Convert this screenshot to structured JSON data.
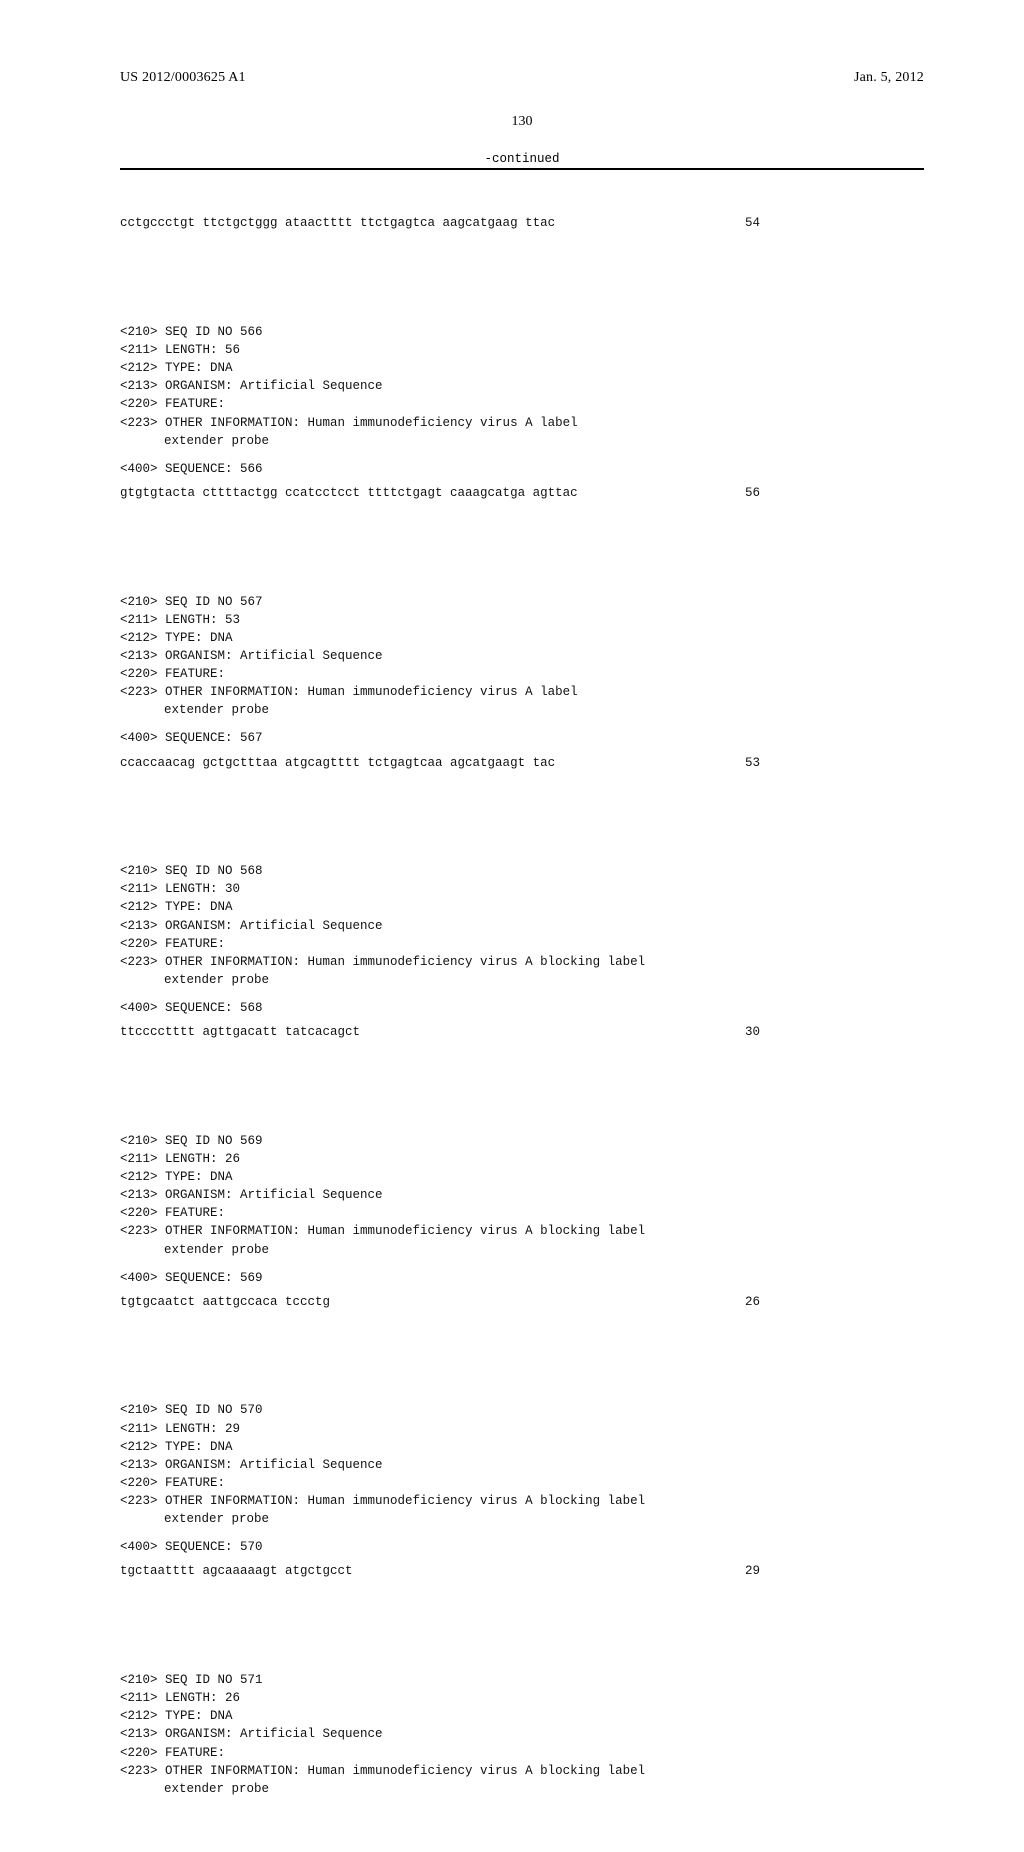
{
  "header": {
    "pub_number": "US 2012/0003625 A1",
    "pub_date": "Jan. 5, 2012"
  },
  "page_number": "130",
  "continued_label": "-continued",
  "initial_seq": {
    "line": "cctgccctgt ttctgctggg ataactttt ttctgagtca aagcatgaag ttac",
    "idx": "54"
  },
  "entries": [
    {
      "seq_id": "<210> SEQ ID NO 566",
      "length": "<211> LENGTH: 56",
      "type": "<212> TYPE: DNA",
      "organism": "<213> ORGANISM: Artificial Sequence",
      "feature": "<220> FEATURE:",
      "other_info_1": "<223> OTHER INFORMATION: Human immunodeficiency virus A label",
      "other_info_2": "extender probe",
      "seq_header": "<400> SEQUENCE: 566",
      "seq_line": "gtgtgtacta cttttactgg ccatcctcct ttttctgagt caaagcatga agttac",
      "seq_idx": "56"
    },
    {
      "seq_id": "<210> SEQ ID NO 567",
      "length": "<211> LENGTH: 53",
      "type": "<212> TYPE: DNA",
      "organism": "<213> ORGANISM: Artificial Sequence",
      "feature": "<220> FEATURE:",
      "other_info_1": "<223> OTHER INFORMATION: Human immunodeficiency virus A label",
      "other_info_2": "extender probe",
      "seq_header": "<400> SEQUENCE: 567",
      "seq_line": "ccaccaacag gctgctttaa atgcagtttt tctgagtcaa agcatgaagt tac",
      "seq_idx": "53"
    },
    {
      "seq_id": "<210> SEQ ID NO 568",
      "length": "<211> LENGTH: 30",
      "type": "<212> TYPE: DNA",
      "organism": "<213> ORGANISM: Artificial Sequence",
      "feature": "<220> FEATURE:",
      "other_info_1": "<223> OTHER INFORMATION: Human immunodeficiency virus A blocking label",
      "other_info_2": "extender probe",
      "seq_header": "<400> SEQUENCE: 568",
      "seq_line": "ttcccctttt agttgacatt tatcacagct",
      "seq_idx": "30"
    },
    {
      "seq_id": "<210> SEQ ID NO 569",
      "length": "<211> LENGTH: 26",
      "type": "<212> TYPE: DNA",
      "organism": "<213> ORGANISM: Artificial Sequence",
      "feature": "<220> FEATURE:",
      "other_info_1": "<223> OTHER INFORMATION: Human immunodeficiency virus A blocking label",
      "other_info_2": "extender probe",
      "seq_header": "<400> SEQUENCE: 569",
      "seq_line": "tgtgcaatct aattgccaca tccctg",
      "seq_idx": "26"
    },
    {
      "seq_id": "<210> SEQ ID NO 570",
      "length": "<211> LENGTH: 29",
      "type": "<212> TYPE: DNA",
      "organism": "<213> ORGANISM: Artificial Sequence",
      "feature": "<220> FEATURE:",
      "other_info_1": "<223> OTHER INFORMATION: Human immunodeficiency virus A blocking label",
      "other_info_2": "extender probe",
      "seq_header": "<400> SEQUENCE: 570",
      "seq_line": "tgctaatttt agcaaaaagt atgctgcct",
      "seq_idx": "29"
    },
    {
      "seq_id": "<210> SEQ ID NO 571",
      "length": "<211> LENGTH: 26",
      "type": "<212> TYPE: DNA",
      "organism": "<213> ORGANISM: Artificial Sequence",
      "feature": "<220> FEATURE:",
      "other_info_1": "<223> OTHER INFORMATION: Human immunodeficiency virus A blocking label",
      "other_info_2": "extender probe",
      "seq_header": "",
      "seq_line": "",
      "seq_idx": ""
    }
  ]
}
